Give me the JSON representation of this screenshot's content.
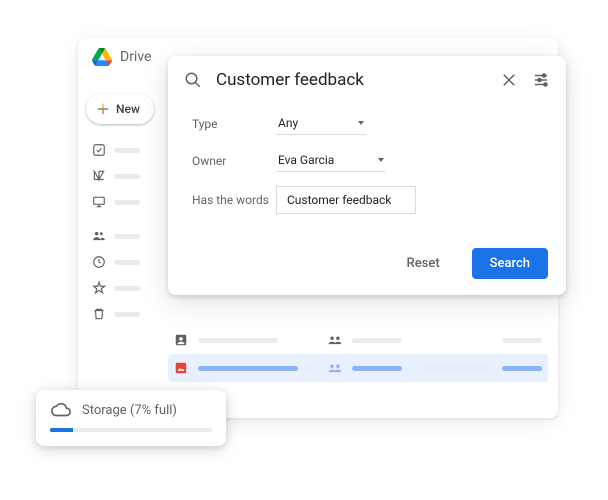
{
  "app": {
    "title": "Drive"
  },
  "sidebar": {
    "new_label": "New"
  },
  "search": {
    "query": "Customer feedback",
    "filters": {
      "type_label": "Type",
      "type_value": "Any",
      "owner_label": "Owner",
      "owner_value": "Eva Garcia",
      "words_label": "Has the words",
      "words_value": "Customer feedback"
    },
    "actions": {
      "reset": "Reset",
      "search": "Search"
    }
  },
  "storage": {
    "label": "Storage (7% full)",
    "percent": 7
  }
}
